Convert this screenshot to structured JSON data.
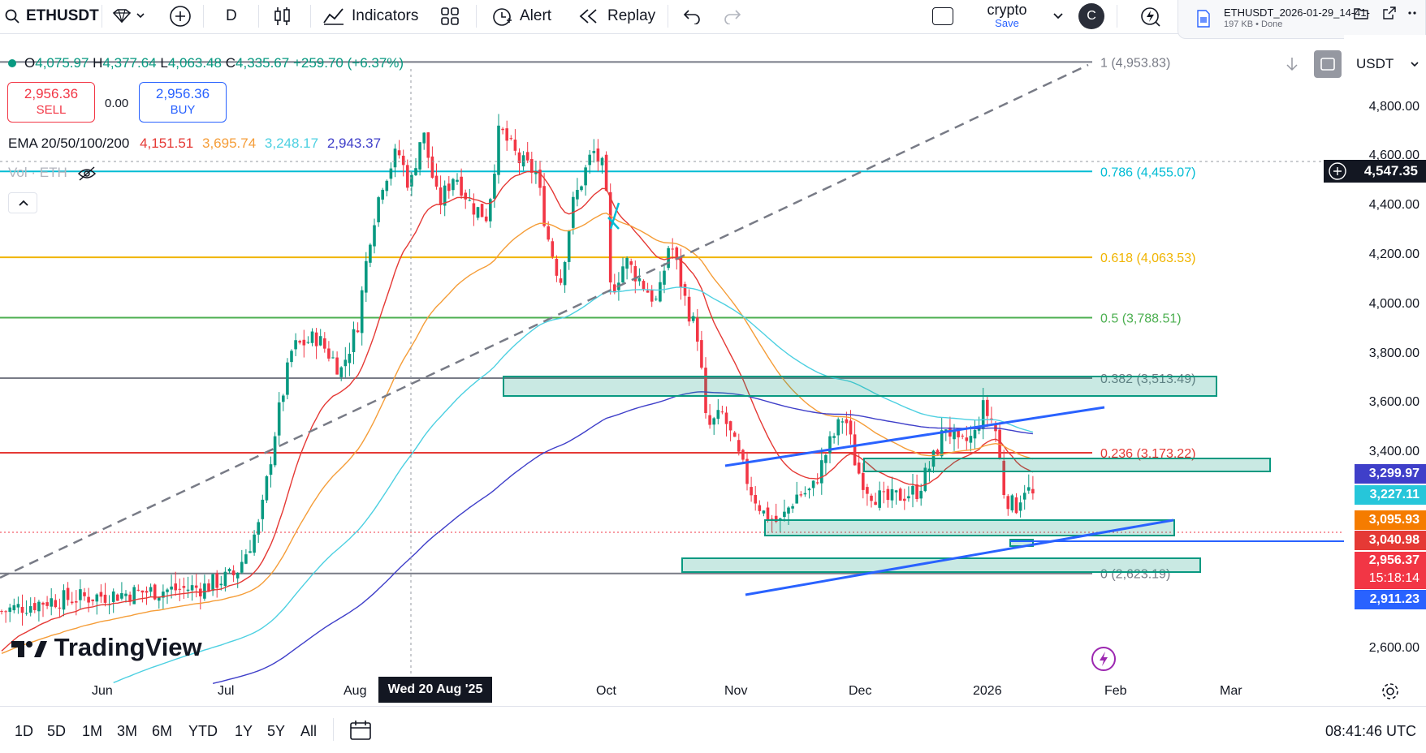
{
  "symbol": "ETHUSDT",
  "toolbar": {
    "interval": "D",
    "indicators_label": "Indicators",
    "alert_label": "Alert",
    "replay_label": "Replay",
    "layout_name": "crypto",
    "save_label": "Save",
    "avatar_letter": "C"
  },
  "download": {
    "filename": "ETHUSDT_2026-01-29_14-41-",
    "meta": "197 KB • Done"
  },
  "ohlc": {
    "o_label": "O",
    "o": "4,075.97",
    "h_label": "H",
    "h": "4,377.64",
    "l_label": "L",
    "l": "4,063.48",
    "c_label": "C",
    "c": "4,335.67",
    "change": "+259.70 (+6.37%)"
  },
  "trade": {
    "sell_price": "2,956.36",
    "sell_label": "SELL",
    "spread": "0.00",
    "buy_price": "2,956.36",
    "buy_label": "BUY"
  },
  "ema": {
    "label": "EMA 20/50/100/200",
    "v20": "4,151.51",
    "v50": "3,695.74",
    "v100": "3,248.17",
    "v200": "2,943.37"
  },
  "vol_label": "Vol · ETH",
  "currency": "USDT",
  "colors": {
    "up": "#089981",
    "down": "#f23645",
    "ema20": "#e53935",
    "ema50": "#f59d38",
    "ema100": "#4dd0e1",
    "ema200": "#3f3fc9",
    "fib786": "#00bcd4",
    "fib618": "#f0b400",
    "fib05": "#4caf50",
    "fib382": "#787b86",
    "fib236": "#e53935",
    "trend": "#2962ff"
  },
  "fib_levels": [
    {
      "label": "1 (4,953.83)",
      "price": 4953.83,
      "color": "#787b86"
    },
    {
      "label": "0.786 (4,455.07)",
      "price": 4455.07,
      "color": "#00bcd4"
    },
    {
      "label": "0.618 (4,063.53)",
      "price": 4063.53,
      "color": "#f0b400"
    },
    {
      "label": "0.5 (3,788.51)",
      "price": 3788.51,
      "color": "#4caf50"
    },
    {
      "label": "0.382 (3,513.49)",
      "price": 3513.49,
      "color": "#787b86"
    },
    {
      "label": "0.236 (3,173.22)",
      "price": 3173.22,
      "color": "#e53935"
    },
    {
      "label": "0 (2,623.19)",
      "price": 2623.19,
      "color": "#787b86"
    }
  ],
  "price_axis": [
    "4,800.00",
    "4,600.00",
    "4,400.00",
    "4,200.00",
    "4,000.00",
    "3,800.00",
    "3,600.00",
    "3,400.00",
    "2,600.00"
  ],
  "price_labels": {
    "crosshair": "4,547.35",
    "ema100_tag": "3,299.97",
    "zone_tag": "3,227.11",
    "ema50_tag": "3,095.93",
    "ema20_tag": "3,040.98",
    "last": "2,956.37",
    "countdown": "15:18:14",
    "ema200_tag": "2,911.23"
  },
  "time_axis": [
    "Jun",
    "Jul",
    "Aug",
    "Oct",
    "Nov",
    "Dec",
    "2026",
    "Feb",
    "Mar"
  ],
  "crosshair_date": "Wed 20 Aug '25",
  "watermark": "TradingView",
  "ranges": [
    "1D",
    "5D",
    "1M",
    "3M",
    "6M",
    "YTD",
    "1Y",
    "5Y",
    "All"
  ],
  "clock": "08:41:46 UTC"
}
